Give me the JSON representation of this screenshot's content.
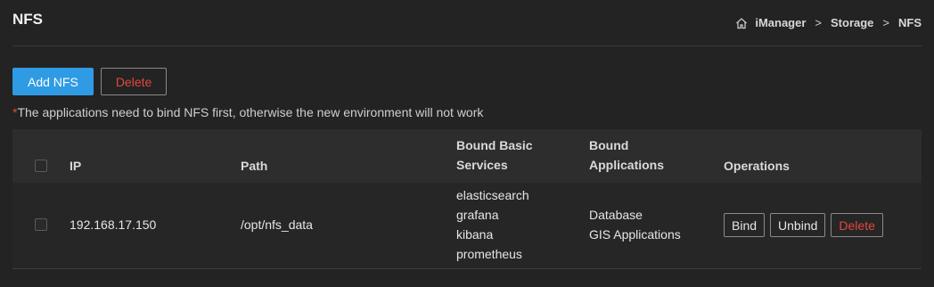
{
  "header": {
    "title": "NFS",
    "breadcrumb": [
      "iManager",
      "Storage",
      "NFS"
    ],
    "breadcrumb_separator": ">"
  },
  "toolbar": {
    "add_label": "Add NFS",
    "delete_label": "Delete"
  },
  "notice": {
    "star": "*",
    "text": "The applications need to bind NFS first, otherwise the new environment will not work"
  },
  "table": {
    "columns": {
      "ip": "IP",
      "path": "Path",
      "services_line1": "Bound Basic",
      "services_line2": "Services",
      "apps_line1": "Bound",
      "apps_line2": "Applications",
      "operations": "Operations"
    },
    "rows": [
      {
        "ip": "192.168.17.150",
        "path": "/opt/nfs_data",
        "services": [
          "elasticsearch",
          "grafana",
          "kibana",
          "prometheus"
        ],
        "applications": [
          "Database",
          "GIS Applications"
        ],
        "operations": {
          "bind": "Bind",
          "unbind": "Unbind",
          "delete": "Delete"
        }
      }
    ]
  },
  "colors": {
    "primary": "#2f9be4",
    "danger": "#e0483e",
    "background": "#232323"
  }
}
